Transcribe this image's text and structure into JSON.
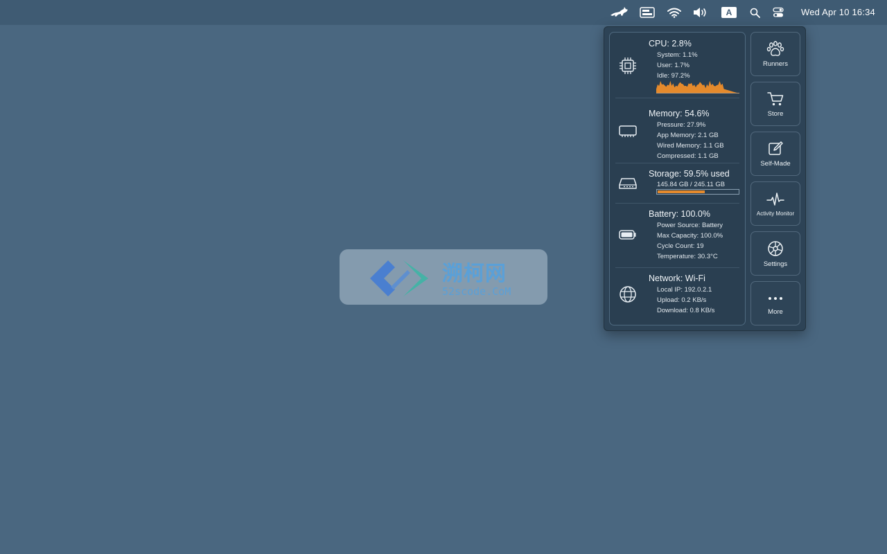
{
  "menubar": {
    "items": [
      {
        "icon": "runcat-icon"
      },
      {
        "icon": "screen-mirroring-icon"
      },
      {
        "icon": "wifi-icon"
      },
      {
        "icon": "volume-icon"
      },
      {
        "icon": "input-source-icon",
        "label": "A"
      },
      {
        "icon": "spotlight-search-icon"
      },
      {
        "icon": "control-center-icon"
      }
    ],
    "clock": "Wed Apr 10  16:34"
  },
  "stats": {
    "cpu": {
      "title": "CPU:  2.8%",
      "system": "System:  1.1%",
      "user": "User:  1.7%",
      "idle": "Idle:  97.2%",
      "graph_color": "#e58a2c"
    },
    "memory": {
      "title": "Memory: 54.6%",
      "pressure": "Pressure: 27.9%",
      "app": "App Memory:  2.1 GB",
      "wired": "Wired Memory:  1.1 GB",
      "compressed": "Compressed:  1.1 GB"
    },
    "storage": {
      "title": "Storage: 59.5% used",
      "detail": "145.84 GB / 245.11 GB",
      "used_fraction": 0.595,
      "bar_color": "#e58a2c"
    },
    "battery": {
      "title": "Battery: 100.0%",
      "source": "Power Source: Battery",
      "capacity": "Max Capacity: 100.0%",
      "cycles": "Cycle Count: 19",
      "temperature": "Temperature: 30.3°C"
    },
    "network": {
      "title": "Network: Wi-Fi",
      "local_ip": "Local IP: 192.0.2.1",
      "upload": "Upload:   0.2 KB/s",
      "download": "Download:   0.8 KB/s"
    }
  },
  "side_buttons": [
    {
      "label": "Runners",
      "icon": "paw-icon"
    },
    {
      "label": "Store",
      "icon": "cart-icon"
    },
    {
      "label": "Self-Made",
      "icon": "edit-icon"
    },
    {
      "label": "Activity Monitor",
      "icon": "pulse-icon"
    },
    {
      "label": "Settings",
      "icon": "gear-icon"
    },
    {
      "label": "More",
      "icon": "ellipsis-icon"
    }
  ],
  "watermark": {
    "title": "溯柯网",
    "subtitle": "52scode.CoM"
  }
}
